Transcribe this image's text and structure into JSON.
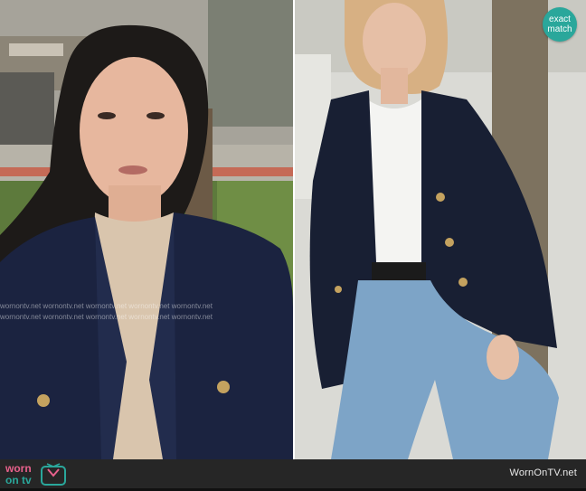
{
  "left_photo": {
    "watermark_line_1": "wornontv.net  wornontv.net  wornontv.net  wornontv.net  wornontv.net",
    "watermark_line_2": "wornontv.net  wornontv.net  wornontv.net  wornontv.net  wornontv.net"
  },
  "right_photo": {
    "badge_line_1": "exact",
    "badge_line_2": "match"
  },
  "footer": {
    "logo_text": "worn on tv",
    "site_text": "WornOnTV.net"
  },
  "colors": {
    "badge": "#2aa79b",
    "footer_bg": "#262626",
    "logo_pink": "#e8618c",
    "logo_teal": "#2aa79b",
    "blazer_navy": "#1b2340"
  }
}
